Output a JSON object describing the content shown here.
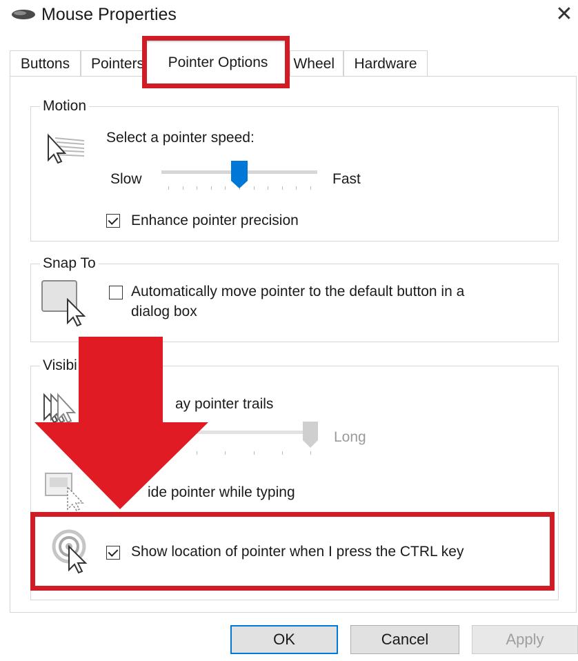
{
  "window": {
    "title": "Mouse Properties",
    "close_glyph": "✕",
    "icon": "mouse-icon"
  },
  "tabs": [
    {
      "label": "Buttons"
    },
    {
      "label": "Pointers"
    },
    {
      "label": "Pointer Options",
      "active": true
    },
    {
      "label": "Wheel"
    },
    {
      "label": "Hardware"
    }
  ],
  "motion": {
    "legend": "Motion",
    "prompt": "Select a pointer speed:",
    "slow_label": "Slow",
    "fast_label": "Fast",
    "speed_level": 0.5,
    "enhance_label": "Enhance pointer precision",
    "enhance_checked": true,
    "icon": "pointer-speed-icon"
  },
  "snap_to": {
    "legend": "Snap To",
    "label_line1": "Automatically move pointer to the default button in a",
    "label_line2": "dialog box",
    "checked": false,
    "icon": "snap-to-button-icon"
  },
  "visibility": {
    "legend": "Visibi",
    "trails_label": "ay pointer trails",
    "long_label": "Long",
    "trail_level": 1.0,
    "hide_label": "ide pointer while typing",
    "ctrl_label": "Show location of pointer when I press the CTRL key",
    "ctrl_checked": true,
    "icons": [
      "pointer-trails-icon",
      "hide-pointer-icon",
      "pointer-location-icon"
    ]
  },
  "buttons": {
    "ok": "OK",
    "cancel": "Cancel",
    "apply": "Apply"
  },
  "colors": {
    "highlight": "#d01c24",
    "slider_thumb": "#0078d7",
    "ok_border": "#0078d7"
  }
}
